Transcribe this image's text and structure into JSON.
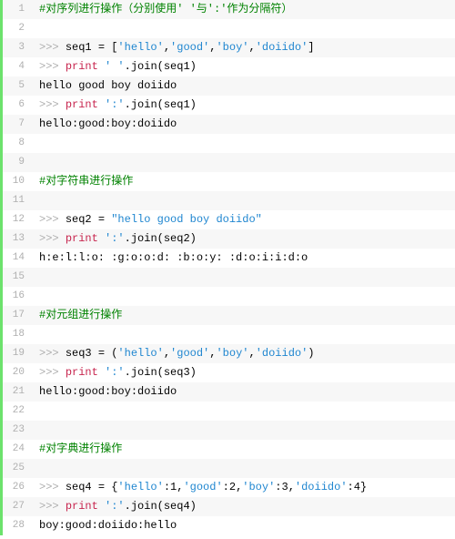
{
  "lines": [
    {
      "num": "1",
      "alt": true,
      "spans": [
        {
          "cls": "comment",
          "text": "#对序列进行操作（分别使用' '与':'作为分隔符）"
        }
      ]
    },
    {
      "num": "2",
      "alt": false,
      "spans": [
        {
          "cls": "plain",
          "text": ""
        }
      ]
    },
    {
      "num": "3",
      "alt": true,
      "spans": [
        {
          "cls": "keyword",
          "text": ">>> "
        },
        {
          "cls": "plain",
          "text": "seq1 = ["
        },
        {
          "cls": "string",
          "text": "'hello'"
        },
        {
          "cls": "plain",
          "text": ","
        },
        {
          "cls": "string",
          "text": "'good'"
        },
        {
          "cls": "plain",
          "text": ","
        },
        {
          "cls": "string",
          "text": "'boy'"
        },
        {
          "cls": "plain",
          "text": ","
        },
        {
          "cls": "string",
          "text": "'doiido'"
        },
        {
          "cls": "plain",
          "text": "]"
        }
      ]
    },
    {
      "num": "4",
      "alt": false,
      "spans": [
        {
          "cls": "keyword",
          "text": ">>> "
        },
        {
          "cls": "print",
          "text": "print"
        },
        {
          "cls": "plain",
          "text": " "
        },
        {
          "cls": "string",
          "text": "' '"
        },
        {
          "cls": "plain",
          "text": ".join(seq1)"
        }
      ]
    },
    {
      "num": "5",
      "alt": true,
      "spans": [
        {
          "cls": "plain",
          "text": "hello good boy doiido"
        }
      ]
    },
    {
      "num": "6",
      "alt": false,
      "spans": [
        {
          "cls": "keyword",
          "text": ">>> "
        },
        {
          "cls": "print",
          "text": "print"
        },
        {
          "cls": "plain",
          "text": " "
        },
        {
          "cls": "string",
          "text": "':'"
        },
        {
          "cls": "plain",
          "text": ".join(seq1)"
        }
      ]
    },
    {
      "num": "7",
      "alt": true,
      "spans": [
        {
          "cls": "plain",
          "text": "hello:good:boy:doiido"
        }
      ]
    },
    {
      "num": "8",
      "alt": false,
      "spans": [
        {
          "cls": "plain",
          "text": ""
        }
      ]
    },
    {
      "num": "9",
      "alt": true,
      "spans": [
        {
          "cls": "plain",
          "text": ""
        }
      ]
    },
    {
      "num": "10",
      "alt": false,
      "spans": [
        {
          "cls": "comment",
          "text": "#对字符串进行操作"
        }
      ]
    },
    {
      "num": "11",
      "alt": true,
      "spans": [
        {
          "cls": "plain",
          "text": ""
        }
      ]
    },
    {
      "num": "12",
      "alt": false,
      "spans": [
        {
          "cls": "keyword",
          "text": ">>> "
        },
        {
          "cls": "plain",
          "text": "seq2 = "
        },
        {
          "cls": "string",
          "text": "\"hello good boy doiido\""
        }
      ]
    },
    {
      "num": "13",
      "alt": true,
      "spans": [
        {
          "cls": "keyword",
          "text": ">>> "
        },
        {
          "cls": "print",
          "text": "print"
        },
        {
          "cls": "plain",
          "text": " "
        },
        {
          "cls": "string",
          "text": "':'"
        },
        {
          "cls": "plain",
          "text": ".join(seq2)"
        }
      ]
    },
    {
      "num": "14",
      "alt": false,
      "spans": [
        {
          "cls": "plain",
          "text": "h:e:l:l:o: :g:o:o:d: :b:o:y: :d:o:i:i:d:o"
        }
      ]
    },
    {
      "num": "15",
      "alt": true,
      "spans": [
        {
          "cls": "plain",
          "text": ""
        }
      ]
    },
    {
      "num": "16",
      "alt": false,
      "spans": [
        {
          "cls": "plain",
          "text": ""
        }
      ]
    },
    {
      "num": "17",
      "alt": true,
      "spans": [
        {
          "cls": "comment",
          "text": "#对元组进行操作"
        }
      ]
    },
    {
      "num": "18",
      "alt": false,
      "spans": [
        {
          "cls": "plain",
          "text": ""
        }
      ]
    },
    {
      "num": "19",
      "alt": true,
      "spans": [
        {
          "cls": "keyword",
          "text": ">>> "
        },
        {
          "cls": "plain",
          "text": "seq3 = ("
        },
        {
          "cls": "string",
          "text": "'hello'"
        },
        {
          "cls": "plain",
          "text": ","
        },
        {
          "cls": "string",
          "text": "'good'"
        },
        {
          "cls": "plain",
          "text": ","
        },
        {
          "cls": "string",
          "text": "'boy'"
        },
        {
          "cls": "plain",
          "text": ","
        },
        {
          "cls": "string",
          "text": "'doiido'"
        },
        {
          "cls": "plain",
          "text": ")"
        }
      ]
    },
    {
      "num": "20",
      "alt": false,
      "spans": [
        {
          "cls": "keyword",
          "text": ">>> "
        },
        {
          "cls": "print",
          "text": "print"
        },
        {
          "cls": "plain",
          "text": " "
        },
        {
          "cls": "string",
          "text": "':'"
        },
        {
          "cls": "plain",
          "text": ".join(seq3)"
        }
      ]
    },
    {
      "num": "21",
      "alt": true,
      "spans": [
        {
          "cls": "plain",
          "text": "hello:good:boy:doiido"
        }
      ]
    },
    {
      "num": "22",
      "alt": false,
      "spans": [
        {
          "cls": "plain",
          "text": ""
        }
      ]
    },
    {
      "num": "23",
      "alt": true,
      "spans": [
        {
          "cls": "plain",
          "text": ""
        }
      ]
    },
    {
      "num": "24",
      "alt": false,
      "spans": [
        {
          "cls": "comment",
          "text": "#对字典进行操作"
        }
      ]
    },
    {
      "num": "25",
      "alt": true,
      "spans": [
        {
          "cls": "plain",
          "text": ""
        }
      ]
    },
    {
      "num": "26",
      "alt": false,
      "spans": [
        {
          "cls": "keyword",
          "text": ">>> "
        },
        {
          "cls": "plain",
          "text": "seq4 = {"
        },
        {
          "cls": "string",
          "text": "'hello'"
        },
        {
          "cls": "plain",
          "text": ":1,"
        },
        {
          "cls": "string",
          "text": "'good'"
        },
        {
          "cls": "plain",
          "text": ":2,"
        },
        {
          "cls": "string",
          "text": "'boy'"
        },
        {
          "cls": "plain",
          "text": ":3,"
        },
        {
          "cls": "string",
          "text": "'doiido'"
        },
        {
          "cls": "plain",
          "text": ":4}"
        }
      ]
    },
    {
      "num": "27",
      "alt": true,
      "spans": [
        {
          "cls": "keyword",
          "text": ">>> "
        },
        {
          "cls": "print",
          "text": "print"
        },
        {
          "cls": "plain",
          "text": " "
        },
        {
          "cls": "string",
          "text": "':'"
        },
        {
          "cls": "plain",
          "text": ".join(seq4)"
        }
      ]
    },
    {
      "num": "28",
      "alt": false,
      "spans": [
        {
          "cls": "plain",
          "text": "boy:good:doiido:hello"
        }
      ]
    }
  ]
}
